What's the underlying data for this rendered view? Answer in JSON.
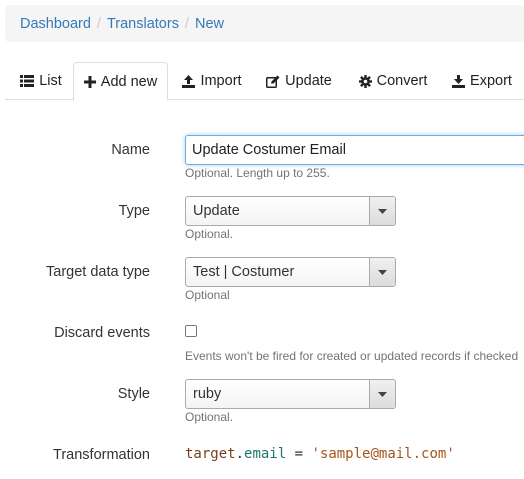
{
  "breadcrumb": {
    "items": [
      "Dashboard",
      "Translators",
      "New"
    ],
    "separator": "/"
  },
  "tabs": [
    {
      "label": "List",
      "icon": "list-icon"
    },
    {
      "label": "Add new",
      "icon": "plus-icon",
      "active": true
    },
    {
      "label": "Import",
      "icon": "upload-icon"
    },
    {
      "label": "Update",
      "icon": "edit-icon"
    },
    {
      "label": "Convert",
      "icon": "gear-icon"
    },
    {
      "label": "Export",
      "icon": "download-icon"
    }
  ],
  "form": {
    "name": {
      "label": "Name",
      "value": "Update Costumer Email",
      "help": "Optional. Length up to 255."
    },
    "type": {
      "label": "Type",
      "value": "Update",
      "help": "Optional."
    },
    "target_data_type": {
      "label": "Target data type",
      "value": "Test | Costumer",
      "help": "Optional"
    },
    "discard_events": {
      "label": "Discard events",
      "checked": false,
      "help": "Events won't be fired for created or updated records if checked"
    },
    "style": {
      "label": "Style",
      "value": "ruby",
      "help": "Optional."
    },
    "transformation": {
      "label": "Transformation",
      "code": {
        "object": "target",
        "dot": ".",
        "property": "email",
        "operator": " = ",
        "string": "'sample@mail.com'"
      }
    }
  },
  "colors": {
    "link": "#337ab7",
    "focus_border": "#66afe9",
    "help_text": "#737373"
  }
}
